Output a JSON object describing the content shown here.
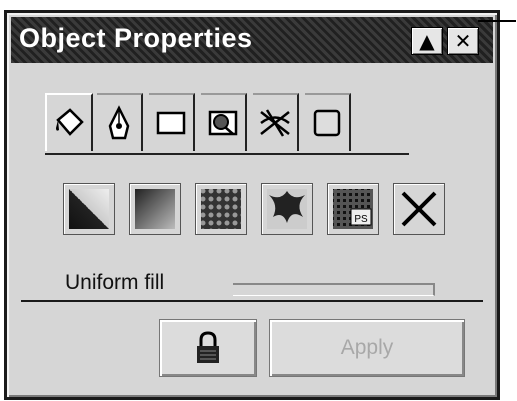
{
  "window": {
    "title": "Object Properties",
    "roll_up_glyph": "▲",
    "close_glyph": "✕"
  },
  "tabs": [
    {
      "icon": "fill-bucket-icon",
      "active": true
    },
    {
      "icon": "pen-nib-icon",
      "active": false
    },
    {
      "icon": "rectangle-icon",
      "active": false
    },
    {
      "icon": "general-icon",
      "active": false
    },
    {
      "icon": "warp-icon",
      "active": false
    },
    {
      "icon": "square-icon",
      "active": false
    }
  ],
  "fill_types": [
    {
      "icon": "uniform-fill-icon"
    },
    {
      "icon": "fountain-fill-icon"
    },
    {
      "icon": "pattern-fill-icon"
    },
    {
      "icon": "texture-fill-icon"
    },
    {
      "icon": "postscript-fill-icon"
    },
    {
      "icon": "no-fill-icon"
    }
  ],
  "section": {
    "label": "Uniform fill"
  },
  "buttons": {
    "lock_icon": "lock-icon",
    "apply_label": "Apply"
  }
}
